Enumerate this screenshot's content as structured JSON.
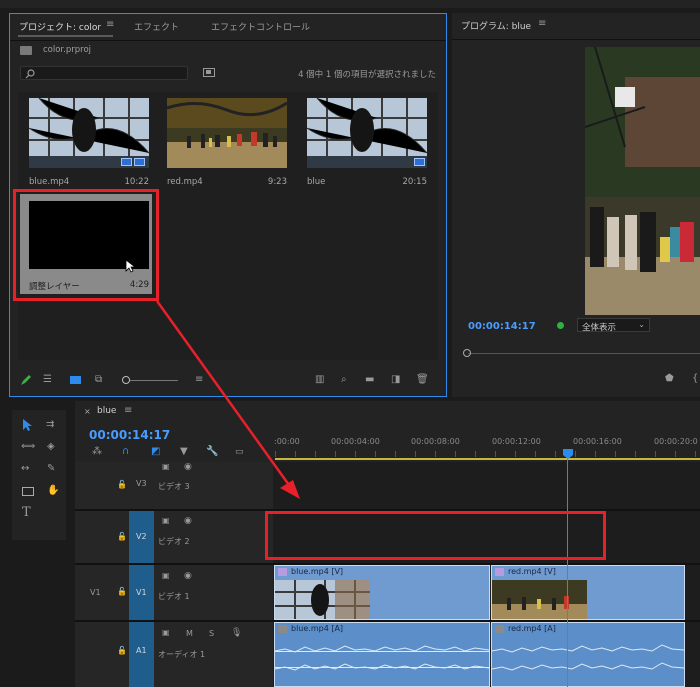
{
  "project": {
    "tabs": [
      "プロジェクト: color",
      "エフェクト",
      "エフェクトコントロール"
    ],
    "filename": "color.prproj",
    "selection_status": "4 個中 1 個の項目が選択されました",
    "clips": [
      {
        "name": "blue.mp4",
        "duration": "10:22"
      },
      {
        "name": "red.mp4",
        "duration": "9:23"
      },
      {
        "name": "blue",
        "duration": "20:15"
      },
      {
        "name": "調整レイヤー",
        "duration": "4:29"
      }
    ]
  },
  "program": {
    "title": "プログラム: blue",
    "timecode": "00:00:14:17",
    "fit_option": "全体表示"
  },
  "timeline": {
    "sequence_tab": "blue",
    "timecode": "00:00:14:17",
    "ruler_ticks": [
      ":00:00",
      "00:00:04:00",
      "00:00:08:00",
      "00:00:12:00",
      "00:00:16:00",
      "00:00:20:0"
    ],
    "tracks": {
      "v3": {
        "id": "V3",
        "name": "ビデオ 3"
      },
      "v2": {
        "id": "V2",
        "name": "ビデオ 2"
      },
      "v1": {
        "src": "V1",
        "id": "V1",
        "name": "ビデオ 1"
      },
      "a1": {
        "id": "A1",
        "name": "オーディオ 1",
        "m": "M",
        "s": "S"
      }
    },
    "clips": {
      "v1_blue": "blue.mp4 [V]",
      "v1_red": "red.mp4 [V]",
      "a1_blue": "blue.mp4 [A]",
      "a1_red": "red.mp4 [A]"
    }
  },
  "colors": {
    "accent": "#2d8ceb",
    "annotation": "#e8202a",
    "playhead": "#2d8ceb",
    "timecode": "#4a9cff",
    "clip_video": "#6f9bd0"
  }
}
